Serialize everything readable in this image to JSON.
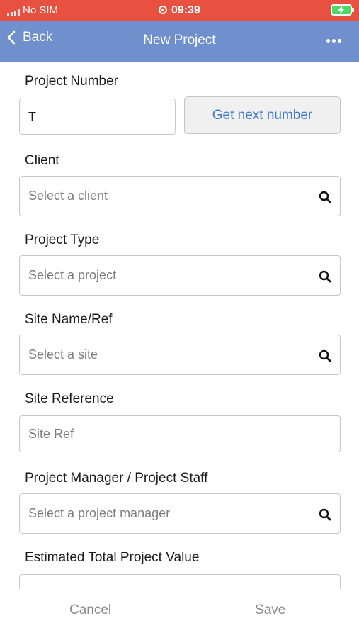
{
  "status_bar": {
    "carrier": "No SIM",
    "time": "09:39",
    "background": "#e8513f"
  },
  "nav": {
    "back_label": "Back",
    "title": "New Project",
    "background": "#6f8fcd",
    "icons": {
      "back": "chevron-left-icon",
      "more": "ellipsis-icon"
    }
  },
  "form": {
    "project_number": {
      "label": "Project Number",
      "value": "T",
      "button_label": "Get next number"
    },
    "client": {
      "label": "Client",
      "placeholder": "Select a client"
    },
    "project_type": {
      "label": "Project Type",
      "placeholder": "Select a project"
    },
    "site_name": {
      "label": "Site Name/Ref",
      "placeholder": "Select a site"
    },
    "site_reference": {
      "label": "Site Reference",
      "placeholder": "Site Ref"
    },
    "project_manager": {
      "label": "Project Manager / Project Staff",
      "placeholder": "Select a project manager"
    },
    "estimated_value": {
      "label": "Estimated Total Project Value"
    }
  },
  "actions": {
    "cancel_label": "Cancel",
    "save_label": "Save"
  },
  "colors": {
    "accent": "#3d78c9",
    "muted_text": "#8a8a8a"
  }
}
